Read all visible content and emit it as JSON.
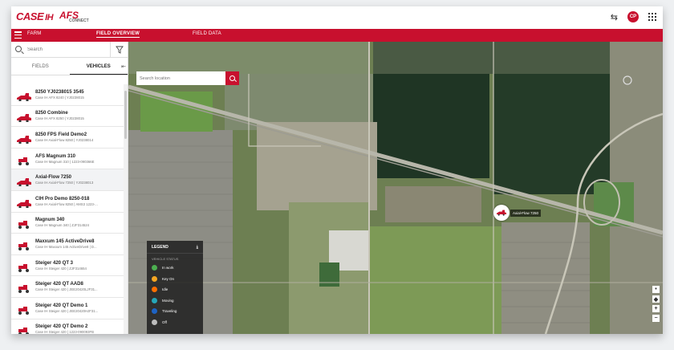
{
  "brand": {
    "case_logo": "CASE",
    "afs_logo": "AFS",
    "afs_sub": "CONNECT",
    "accent_color": "#c8102e"
  },
  "user": {
    "initials": "CP"
  },
  "nav": {
    "items": [
      {
        "label": "FARM"
      },
      {
        "label": "FIELD OVERVIEW"
      },
      {
        "label": "FIELD DATA"
      }
    ],
    "active": "FIELD OVERVIEW"
  },
  "sidebar": {
    "search_placeholder": "Search",
    "tabs": [
      {
        "label": "FIELDS"
      },
      {
        "label": "VEHICLES"
      }
    ],
    "active_tab": "VEHICLES",
    "vehicles": [
      {
        "name": "8250 YJ0238015 3545",
        "sub": "Case IH AFX 8240 | YJ0238015",
        "icon": "combine-icon"
      },
      {
        "name": "8250 Combine",
        "sub": "Case IH AFX 8250 | YJ0238015",
        "icon": "combine-icon"
      },
      {
        "name": "8250 FPS Field Demo2",
        "sub": "Case IH Axial-Flow 8250 | YJ0238014",
        "icon": "combine-icon"
      },
      {
        "name": "AFS Magnum 310",
        "sub": "Case IH Magnum 310 | 1223-090366E",
        "icon": "tractor-icon"
      },
      {
        "name": "Axial-Flow 7250",
        "sub": "Case IH Axial-Flow 7250 | YJ0238013",
        "icon": "combine-icon"
      },
      {
        "name": "CIH Pro Demo 8250-018",
        "sub": "Case IH Axial-Flow 8250 | AMS3 1223-...",
        "icon": "combine-icon"
      },
      {
        "name": "Magnum 340",
        "sub": "Case IH Magnum 340 | ZJF314524",
        "icon": "tractor-icon"
      },
      {
        "name": "Maxxum 145 ActiveDrive8",
        "sub": "Case IH Maxxum 145 ActiveDrive8 | D...",
        "icon": "tractor-icon"
      },
      {
        "name": "Steiger 420 QT 3",
        "sub": "Case IH Steiger 420 | ZJF314654",
        "icon": "tractor-icon"
      },
      {
        "name": "Steiger 420 QT AAD8",
        "sub": "Case IH Steiger 420 | JEE20420LJF31...",
        "icon": "tractor-icon"
      },
      {
        "name": "Steiger 420 QT Demo 1",
        "sub": "Case IH Steiger 420 | JEE20420HJF31...",
        "icon": "tractor-icon"
      },
      {
        "name": "Steiger 420 QT Demo 2",
        "sub": "Case IH Steiger 420 | 1223-090093FB",
        "icon": "tractor-icon"
      }
    ]
  },
  "map": {
    "search_placeholder": "Search location",
    "marker_label": "Axial-Flow 7250",
    "legend": {
      "title": "LEGEND",
      "subtitle": "VEHICLE STATUS",
      "items": [
        {
          "label": "In work",
          "color": "#4caf50"
        },
        {
          "label": "Key On",
          "color": "#f5a623"
        },
        {
          "label": "Idle",
          "color": "#ff6f00"
        },
        {
          "label": "Moving",
          "color": "#26a6b8"
        },
        {
          "label": "Traveling",
          "color": "#1e63c4"
        },
        {
          "label": "Off",
          "color": "#bdbdbd"
        }
      ]
    }
  }
}
